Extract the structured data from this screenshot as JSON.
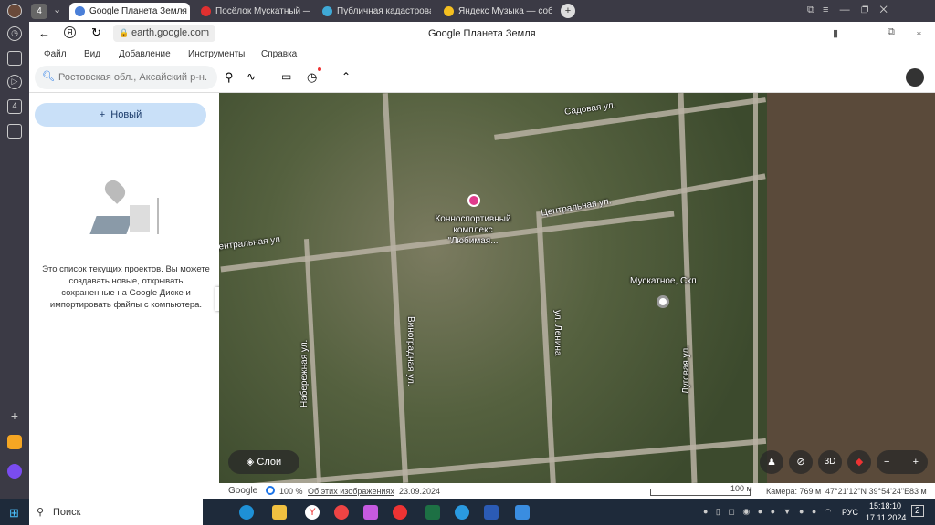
{
  "browser": {
    "tab_count": "4",
    "tabs": [
      {
        "title": "Google Планета Земля",
        "active": true,
        "color": "#4a7fd8"
      },
      {
        "title": "Посёлок Мускатный — Я",
        "color": "#e03030"
      },
      {
        "title": "Публичная кадастровая",
        "color": "#3fa9d6"
      },
      {
        "title": "Яндекс Музыка — собир",
        "color": "#f5c020"
      }
    ],
    "url": "earth.google.com",
    "page_title": "Google Планета Земля"
  },
  "menu": [
    "Файл",
    "Вид",
    "Добавление",
    "Инструменты",
    "Справка"
  ],
  "search": {
    "placeholder": "Ростовская обл., Аксайский р-н."
  },
  "panel": {
    "new_button": "Новый",
    "empty_text": "Это список текущих проектов. Вы можете создавать новые, открывать сохраненные на Google Диске и импортировать файлы с компьютера."
  },
  "map": {
    "streets": [
      "Садовая ул.",
      "Центральная ул.",
      "Центральная ул",
      "Виноградная ул.",
      "ул. Ленина",
      "Луговая ул.",
      "Набережная ул."
    ],
    "poi": "Конноспортивный комплекс \"Любимая...",
    "place": "Мускатное, Схп",
    "layers_button": "Слои",
    "btn_3d": "3D",
    "zoom_out": "−",
    "zoom_in": "+"
  },
  "footer": {
    "brand": "Google",
    "loading": "100 %",
    "about": "Об этих изображениях",
    "date": "23.09.2024",
    "scale": "100 м",
    "camera": "Камера: 769 м",
    "coords": "47°21'12\"N 39°54'24\"E",
    "elevation": "83 м"
  },
  "taskbar": {
    "search": "Поиск",
    "lang": "РУС",
    "time": "15:18:10",
    "date": "17.11.2024",
    "notifications": "2"
  }
}
